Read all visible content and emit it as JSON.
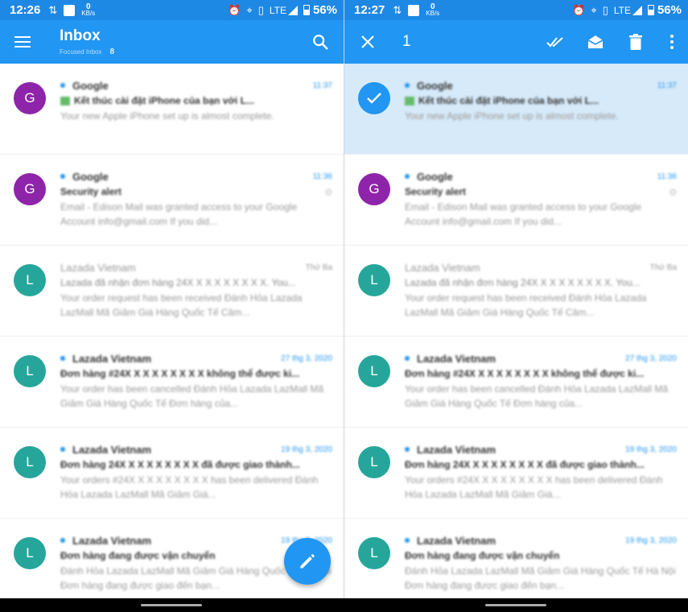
{
  "left": {
    "status": {
      "time": "12:26",
      "data_rate": "0",
      "data_unit": "KB/s",
      "network": "LTE",
      "battery": "56%"
    },
    "appbar": {
      "title": "Inbox",
      "subtitle": "Focused Inbox",
      "count": "8"
    },
    "emails": [
      {
        "avatar": "G",
        "color": "#8e24aa",
        "unread": true,
        "sender": "Google",
        "date": "11:37",
        "subject": "Kết thúc cài đặt iPhone của bạn với L...",
        "preview": "Your new Apple iPhone set up is almost complete.",
        "attachment": true
      },
      {
        "avatar": "G",
        "color": "#8e24aa",
        "unread": true,
        "sender": "Google",
        "date": "11:36",
        "subject": "Security alert",
        "preview": "Email - Edison Mail was granted access to your Google Account info@gmail.com If you did...",
        "flag": "⊙"
      },
      {
        "avatar": "L",
        "color": "#26a69a",
        "unread": false,
        "sender": "Lazada Vietnam",
        "date": "Thứ Ba",
        "subject": "Lazada đã nhận đơn hàng 24X X X X X X X X X. You...",
        "preview": "Your order request has been received Đánh Hỏa Lazada LazMall Mã Giảm Giá Hàng Quốc Tế Câm..."
      },
      {
        "avatar": "L",
        "color": "#26a69a",
        "unread": true,
        "sender": "Lazada Vietnam",
        "date": "27 thg 3, 2020",
        "subject": "Đơn hàng #24X X X X X X X X X không thể được ki...",
        "preview": "Your order has been cancelled Đánh Hỏa Lazada LazMall Mã Giảm Giá Hàng Quốc Tế Đơn hàng của..."
      },
      {
        "avatar": "L",
        "color": "#26a69a",
        "unread": true,
        "sender": "Lazada Vietnam",
        "date": "19 thg 3, 2020",
        "subject": "Đơn hàng 24X X X X X X X X X đã được giao thành...",
        "preview": "Your orders #24X X X X X X X X X has been delivered Đánh Hỏa Lazada LazMall Mã Giảm Giá..."
      },
      {
        "avatar": "L",
        "color": "#26a69a",
        "unread": true,
        "sender": "Lazada Vietnam",
        "date": "19 thg 3, 2020",
        "subject": "Đơn hàng đang được vận chuyển",
        "preview": "Đánh Hỏa Lazada LazMall Mã Giảm Giá Hàng Quốc Tế Hà Nội Đơn hàng đang được giao đến bạn..."
      }
    ]
  },
  "right": {
    "status": {
      "time": "12:27",
      "data_rate": "0",
      "data_unit": "KB/s",
      "network": "LTE",
      "battery": "56%"
    },
    "appbar": {
      "selected_count": "1"
    },
    "emails": [
      {
        "avatar": "G",
        "color": "#8e24aa",
        "unread": true,
        "selected": true,
        "sender": "Google",
        "date": "11:37",
        "subject": "Kết thúc cài đặt iPhone của bạn với L...",
        "preview": "Your new Apple iPhone set up is almost complete.",
        "attachment": true
      },
      {
        "avatar": "G",
        "color": "#8e24aa",
        "unread": true,
        "sender": "Google",
        "date": "11:36",
        "subject": "Security alert",
        "preview": "Email - Edison Mail was granted access to your Google Account info@gmail.com If you did...",
        "flag": "⊙"
      },
      {
        "avatar": "L",
        "color": "#26a69a",
        "unread": false,
        "sender": "Lazada Vietnam",
        "date": "Thứ Ba",
        "subject": "Lazada đã nhận đơn hàng 24X X X X X X X X X. You...",
        "preview": "Your order request has been received Đánh Hỏa Lazada LazMall Mã Giảm Giá Hàng Quốc Tế Câm..."
      },
      {
        "avatar": "L",
        "color": "#26a69a",
        "unread": true,
        "sender": "Lazada Vietnam",
        "date": "27 thg 3, 2020",
        "subject": "Đơn hàng #24X X X X X X X X X không thể được ki...",
        "preview": "Your order has been cancelled Đánh Hỏa Lazada LazMall Mã Giảm Giá Hàng Quốc Tế Đơn hàng của..."
      },
      {
        "avatar": "L",
        "color": "#26a69a",
        "unread": true,
        "sender": "Lazada Vietnam",
        "date": "19 thg 3, 2020",
        "subject": "Đơn hàng 24X X X X X X X X X đã được giao thành...",
        "preview": "Your orders #24X X X X X X X X X has been delivered Đánh Hỏa Lazada LazMall Mã Giảm Giá..."
      },
      {
        "avatar": "L",
        "color": "#26a69a",
        "unread": true,
        "sender": "Lazada Vietnam",
        "date": "19 thg 3, 2020",
        "subject": "Đơn hàng đang được vận chuyển",
        "preview": "Đánh Hỏa Lazada LazMall Mã Giảm Giá Hàng Quốc Tế Hà Nội Đơn hàng đang được giao đến bạn..."
      }
    ]
  },
  "colors": {
    "appbar": "#2196f3",
    "statusbar": "#1e88e5",
    "selected_row": "#d7eaf9",
    "accent": "#2196f3"
  },
  "icons": {
    "menu": "hamburger-icon",
    "search": "search-icon",
    "close": "close-icon",
    "mark_read": "double-check-icon",
    "envelope": "envelope-open-icon",
    "delete": "trash-icon",
    "more": "more-vert-icon",
    "compose": "pencil-icon"
  }
}
